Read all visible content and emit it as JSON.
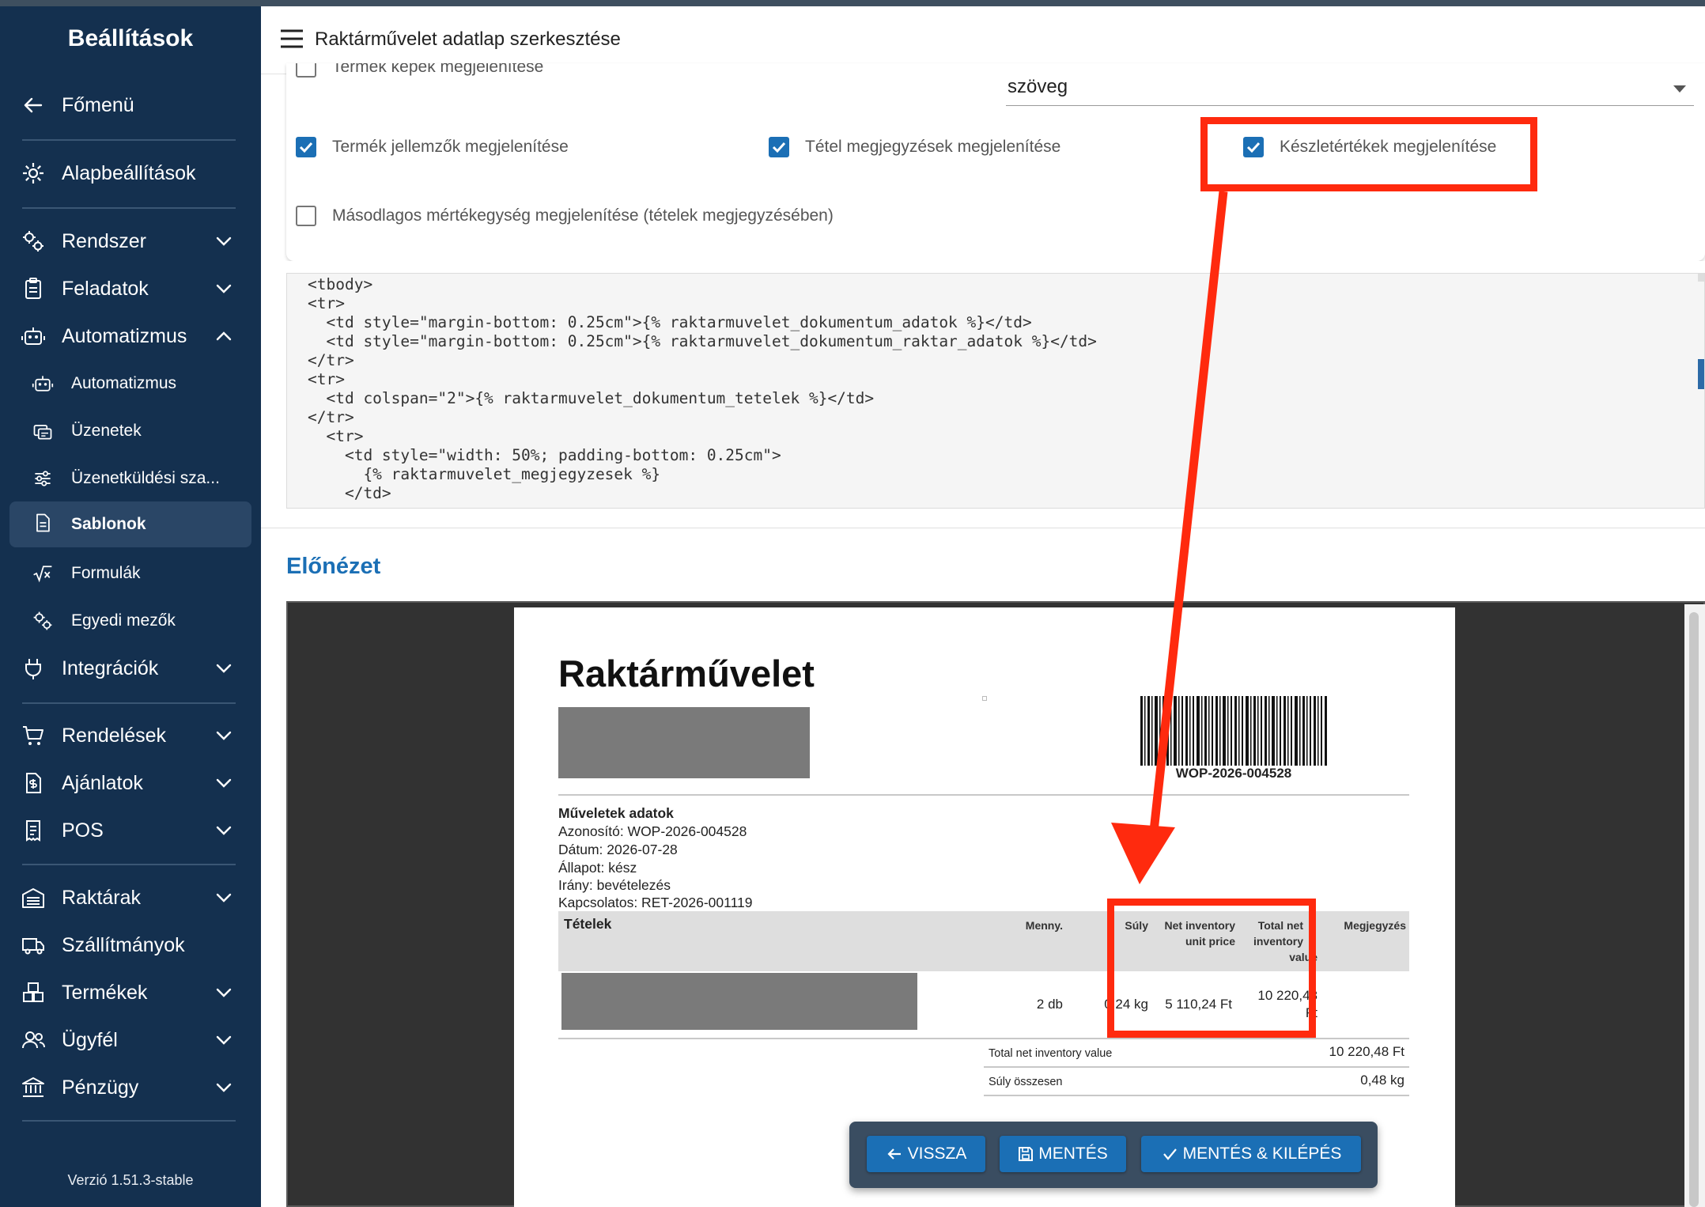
{
  "sidebar": {
    "title": "Beállítások",
    "items": [
      {
        "label": "Főmenü",
        "icon": "arrow-left-icon"
      },
      {
        "label": "Alapbeállítások",
        "icon": "gear-icon"
      },
      {
        "label": "Rendszer",
        "icon": "gears-icon"
      },
      {
        "label": "Feladatok",
        "icon": "clipboard-icon"
      },
      {
        "label": "Automatizmus",
        "icon": "robot-icon"
      },
      {
        "label": "Automatizmus",
        "icon": "robot-icon"
      },
      {
        "label": "Üzenetek",
        "icon": "messages-icon"
      },
      {
        "label": "Üzenetküldési sza...",
        "icon": "sliders-icon"
      },
      {
        "label": "Sablonok",
        "icon": "document-icon"
      },
      {
        "label": "Formulák",
        "icon": "sqrt-icon"
      },
      {
        "label": "Egyedi mezők",
        "icon": "gears-icon"
      },
      {
        "label": "Integrációk",
        "icon": "plug-icon"
      },
      {
        "label": "Rendelések",
        "icon": "cart-icon"
      },
      {
        "label": "Ajánlatok",
        "icon": "invoice-icon"
      },
      {
        "label": "POS",
        "icon": "receipt-icon"
      },
      {
        "label": "Raktárak",
        "icon": "warehouse-icon"
      },
      {
        "label": "Szállítmányok",
        "icon": "truck-icon"
      },
      {
        "label": "Termékek",
        "icon": "boxes-icon"
      },
      {
        "label": "Ügyfél",
        "icon": "users-icon"
      },
      {
        "label": "Pénzügy",
        "icon": "bank-icon"
      }
    ],
    "version": "Verzió 1.51.3-stable"
  },
  "header": {
    "title": "Raktárművelet adatlap szerkesztése"
  },
  "settings": {
    "cut_checkbox": "Termék képek megjelenítése",
    "select_value": "szöveg",
    "checkboxes": [
      {
        "label": "Termék jellemzők megjelenítése",
        "checked": true
      },
      {
        "label": "Tétel megjegyzések megjelenítése",
        "checked": true
      },
      {
        "label": "Készletértékek megjelenítése",
        "checked": true
      },
      {
        "label": "Másodlagos mértékegység megjelenítése (tételek megjegyzésében)",
        "checked": false
      }
    ]
  },
  "code": "<tbody>\n<tr>\n  <td style=\"margin-bottom: 0.25cm\">{% raktarmuvelet_dokumentum_adatok %}</td>\n  <td style=\"margin-bottom: 0.25cm\">{% raktarmuvelet_dokumentum_raktar_adatok %}</td>\n</tr>\n<tr>\n  <td colspan=\"2\">{% raktarmuvelet_dokumentum_tetelek %}</td>\n</tr>\n  <tr>\n    <td style=\"width: 50%; padding-bottom: 0.25cm\">\n      {% raktarmuvelet_megjegyzesek %}\n    </td>",
  "preview": {
    "title": "Előnézet",
    "doc_title": "Raktárművelet",
    "barcode_number": "WOP-2026-004528",
    "section_title": "Műveletek adatok",
    "lines": [
      "Azonosító: WOP-2026-004528",
      "Dátum: 2026-07-28",
      "Állapot: kész",
      "Irány: bevételezés",
      "Kapcsolatos: RET-2026-001119"
    ],
    "table": {
      "title": "Tételek",
      "headers": {
        "qty": "Menny.",
        "weight": "Súly",
        "unit_price_1": "Net inventory",
        "unit_price_2": "unit price",
        "total_1": "Total net",
        "total_2": "inventory",
        "total_3": "value",
        "note": "Megjegyzés"
      },
      "row": {
        "qty": "2 db",
        "weight": "0,24 kg",
        "unit_price": "5 110,24 Ft",
        "total_1": "10 220,48",
        "total_2": "Ft"
      }
    },
    "summary": [
      {
        "label": "Total net inventory value",
        "value": "10 220,48 Ft"
      },
      {
        "label": "Súly összesen",
        "value": "0,48 kg"
      }
    ]
  },
  "actions": {
    "back": "VISSZA",
    "save": "MENTÉS",
    "save_exit": "MENTÉS & KILÉPÉS"
  },
  "colors": {
    "sidebar": "#14304f",
    "accent": "#1b6fb5",
    "annotation": "#ff2a0e"
  }
}
